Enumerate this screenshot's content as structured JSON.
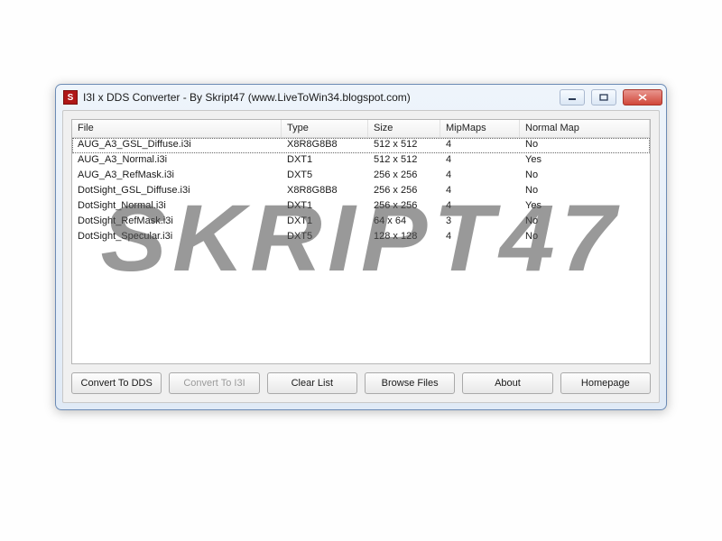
{
  "window": {
    "title": "I3I x DDS Converter - By Skript47 (www.LiveToWin34.blogspot.com)",
    "icon_text": "S"
  },
  "columns": {
    "file": "File",
    "type": "Type",
    "size": "Size",
    "mipmaps": "MipMaps",
    "normal": "Normal Map"
  },
  "rows": [
    {
      "file": "AUG_A3_GSL_Diffuse.i3i",
      "type": "X8R8G8B8",
      "size": "512 x 512",
      "mip": "4",
      "normal": "No"
    },
    {
      "file": "AUG_A3_Normal.i3i",
      "type": "DXT1",
      "size": "512 x 512",
      "mip": "4",
      "normal": "Yes"
    },
    {
      "file": "AUG_A3_RefMask.i3i",
      "type": "DXT5",
      "size": "256 x 256",
      "mip": "4",
      "normal": "No"
    },
    {
      "file": "DotSight_GSL_Diffuse.i3i",
      "type": "X8R8G8B8",
      "size": "256 x 256",
      "mip": "4",
      "normal": "No"
    },
    {
      "file": "DotSight_Normal.i3i",
      "type": "DXT1",
      "size": "256 x 256",
      "mip": "4",
      "normal": "Yes"
    },
    {
      "file": "DotSight_RefMask.i3i",
      "type": "DXT1",
      "size": "64 x 64",
      "mip": "3",
      "normal": "No"
    },
    {
      "file": "DotSight_Specular.i3i",
      "type": "DXT5",
      "size": "128 x 128",
      "mip": "4",
      "normal": "No"
    }
  ],
  "buttons": {
    "convert_dds": "Convert To DDS",
    "convert_i3i": "Convert To I3I",
    "clear": "Clear List",
    "browse": "Browse Files",
    "about": "About",
    "homepage": "Homepage"
  },
  "watermark": "SKRIPT47"
}
